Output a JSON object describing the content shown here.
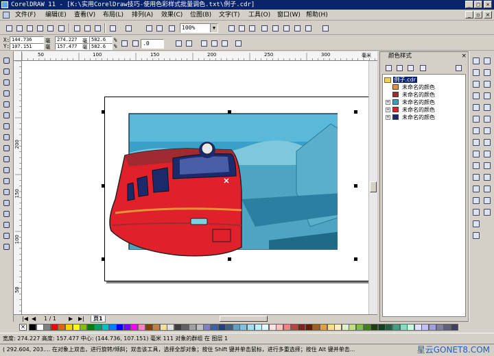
{
  "window": {
    "title": "CorelDRAW 11 - [K:\\实用CorelDraw技巧-使用色彩样式批量调色.txt\\例子.cdr]",
    "minimize": "_",
    "maximize": "□",
    "close": "×",
    "doc_minimize": "_",
    "doc_restore": "▫",
    "doc_close": "×"
  },
  "menu": {
    "file": "文件(F)",
    "edit": "编辑(E)",
    "view": "查看(V)",
    "layout": "布局(L)",
    "arrange": "排列(A)",
    "effects": "效果(C)",
    "bitmaps": "位图(B)",
    "text": "文字(T)",
    "tools": "工具(O)",
    "window": "窗口(W)",
    "help": "帮助(H)"
  },
  "toolbar": {
    "zoom_value": "100%"
  },
  "property_bar": {
    "x": "144.736",
    "y": "107.151",
    "w": "274.227",
    "h": "157.477",
    "scale_x": "582.6",
    "scale_y": "582.6",
    "mm_unit": "毫",
    "pct_unit": "%",
    "rotation": ".0",
    "x_label": "X:",
    "y_label": "Y:"
  },
  "rulers": {
    "h_labels": [
      "50",
      "100",
      "150",
      "200",
      "250",
      "300"
    ],
    "unit": "毫米",
    "v_labels": [
      "200",
      "150",
      "100",
      "50"
    ]
  },
  "page_nav": {
    "counter": "1 / 1",
    "tab": "页1",
    "first": "|◀",
    "prev": "◀",
    "next": "▶",
    "last": "▶|"
  },
  "docker": {
    "title": "颜色样式",
    "root": "例子.cdr",
    "items": [
      {
        "label": "未命名的颜色",
        "color": "#e8903a"
      },
      {
        "label": "未命名的颜色",
        "color": "#a02a30"
      },
      {
        "label": "未命名的颜色",
        "color": "#3aa0c8"
      },
      {
        "label": "未命名的颜色",
        "color": "#e0202a"
      },
      {
        "label": "未命名的颜色",
        "color": "#1a2a6a"
      }
    ]
  },
  "status": {
    "line1": "宽度: 274.227  高度: 157.477  中心: (144.736, 107.151)  毫米        111 对象的群组 在 图层 1",
    "line2": "( 292.604, 203....   在对象上双击，进行旋转/倾斜；双击该工具，选择全部对象；按住 Shift 键并单击鼠标，进行多重选择；按住 Alt 键并单击...",
    "watermark": "星云GONET8.COM"
  },
  "palette": [
    "#000000",
    "#ffffff",
    "#808080",
    "#ff0000",
    "#e06010",
    "#ffd000",
    "#ffff00",
    "#80c000",
    "#008000",
    "#00a060",
    "#00c0c0",
    "#0080ff",
    "#0000ff",
    "#8000ff",
    "#ff00ff",
    "#ff80c0",
    "#804000",
    "#c08040",
    "#f0e0a0",
    "#e0e0e0",
    "#404040",
    "#606060",
    "#a0a0a0",
    "#c0c0c0",
    "#8080c0",
    "#4060a0",
    "#204080",
    "#406080",
    "#60a0c0",
    "#80c0e0",
    "#a0e0f0",
    "#c0f0ff",
    "#e0ffff",
    "#ffe0e0",
    "#ffc0c0",
    "#ff8080",
    "#c04040",
    "#802020",
    "#602000",
    "#a06020",
    "#e0a040",
    "#ffe080",
    "#fff0c0",
    "#e0f0c0",
    "#c0e080",
    "#80c040",
    "#408020",
    "#204010",
    "#104020",
    "#206040",
    "#40a080",
    "#80e0c0",
    "#c0ffe0",
    "#e0e0ff",
    "#c0c0ff",
    "#a0a0e0",
    "#8080a0",
    "#606080",
    "#404060",
    "#ffffe0",
    "#f0f0a0",
    "#e0e060"
  ],
  "colors": {
    "train_body": "#e0202a",
    "train_dark": "#a02a30",
    "sky": "#3aa0c8",
    "window_blue": "#1a2a6a",
    "accent_orange": "#e8903a"
  }
}
